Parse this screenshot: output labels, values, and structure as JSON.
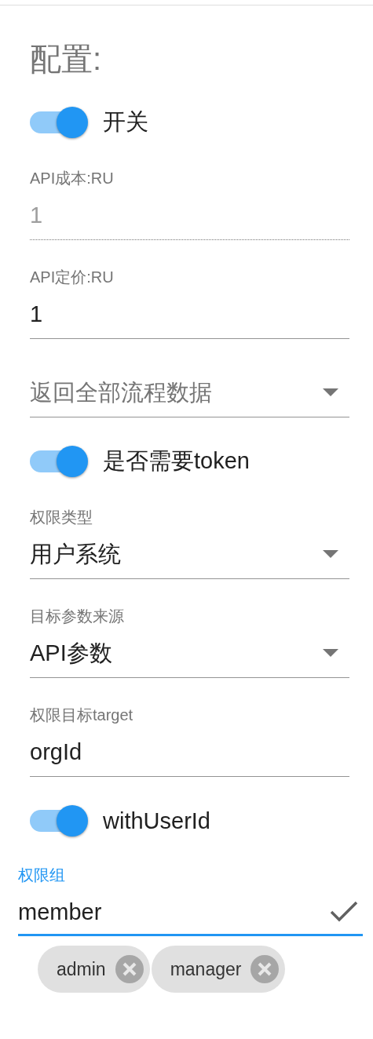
{
  "section_title": "配置:",
  "items": [
    {
      "kind": "toggle",
      "label": "开关",
      "on": true
    },
    {
      "kind": "text",
      "label": "API成本:RU",
      "value": "1",
      "disabled": true
    },
    {
      "kind": "text",
      "label": "API定价:RU",
      "value": "1",
      "disabled": false
    },
    {
      "kind": "select",
      "placeholder": "返回全部流程数据"
    },
    {
      "kind": "toggle",
      "label": "是否需要token",
      "on": true
    },
    {
      "kind": "select",
      "label": "权限类型",
      "value": "用户系统"
    },
    {
      "kind": "select",
      "label": "目标参数来源",
      "value": "API参数"
    },
    {
      "kind": "text",
      "label": "权限目标target",
      "value": "orgId",
      "disabled": false
    },
    {
      "kind": "toggle",
      "label": "withUserId",
      "on": true
    }
  ],
  "permission_group": {
    "label": "权限组",
    "value": "member",
    "focused": true,
    "chips": [
      {
        "label": "admin"
      },
      {
        "label": "manager"
      }
    ]
  }
}
